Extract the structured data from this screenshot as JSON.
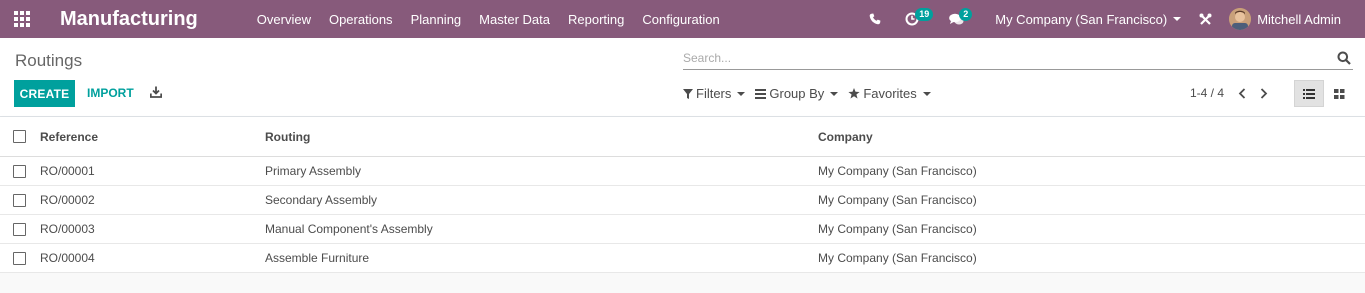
{
  "navbar": {
    "app_title": "Manufacturing",
    "menu": [
      {
        "label": "Overview"
      },
      {
        "label": "Operations"
      },
      {
        "label": "Planning"
      },
      {
        "label": "Master Data"
      },
      {
        "label": "Reporting"
      },
      {
        "label": "Configuration"
      }
    ],
    "activity_count": "19",
    "messages_count": "2",
    "company": "My Company (San Francisco)",
    "user": "Mitchell Admin"
  },
  "control_panel": {
    "breadcrumb": "Routings",
    "search_placeholder": "Search...",
    "create_label": "CREATE",
    "import_label": "IMPORT",
    "filters_label": "Filters",
    "group_by_label": "Group By",
    "favorites_label": "Favorites",
    "pager": "1-4 / 4"
  },
  "table": {
    "columns": {
      "reference": "Reference",
      "routing": "Routing",
      "company": "Company"
    },
    "rows": [
      {
        "reference": "RO/00001",
        "routing": "Primary Assembly",
        "company": "My Company (San Francisco)"
      },
      {
        "reference": "RO/00002",
        "routing": "Secondary Assembly",
        "company": "My Company (San Francisco)"
      },
      {
        "reference": "RO/00003",
        "routing": "Manual Component's Assembly",
        "company": "My Company (San Francisco)"
      },
      {
        "reference": "RO/00004",
        "routing": "Assemble Furniture",
        "company": "My Company (San Francisco)"
      }
    ]
  },
  "colors": {
    "brand": "#875a7b",
    "accent": "#00a09d"
  }
}
